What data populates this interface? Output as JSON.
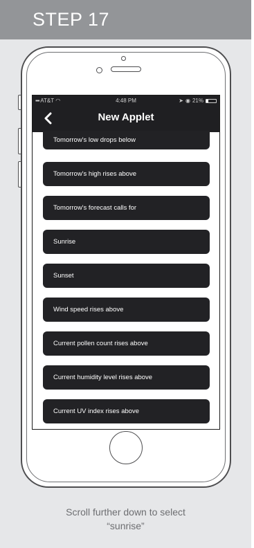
{
  "step": {
    "label": "STEP 17"
  },
  "status_bar": {
    "carrier": "AT&T",
    "time": "4:48 PM",
    "battery": "21%",
    "battery_level": 0.21
  },
  "nav": {
    "title": "New Applet",
    "back_icon": "chevron-left-icon"
  },
  "list": {
    "items": [
      "Tomorrow's low drops below",
      "Tomorrow's high rises above",
      "Tomorrow's forecast calls for",
      "Sunrise",
      "Sunset",
      "Wind speed rises above",
      "Current pollen count rises above",
      "Current humidity level rises above",
      "Current UV index rises above"
    ]
  },
  "caption": {
    "line1": "Scroll further down to select",
    "line2": "“sunrise”"
  },
  "colors": {
    "header_bg": "#939598",
    "card_bg": "#e6e7e9",
    "item_bg": "#222225",
    "topbar_bg": "#1f1f22"
  }
}
